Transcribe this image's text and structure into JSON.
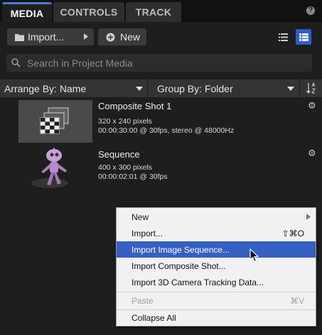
{
  "tabs": [
    {
      "label": "MEDIA",
      "active": true
    },
    {
      "label": "CONTROLS",
      "active": false
    },
    {
      "label": "TRACK",
      "active": false
    }
  ],
  "help_label": "?",
  "toolbar": {
    "import_label": "Import...",
    "new_label": "New"
  },
  "search": {
    "placeholder": "Search in Project Media",
    "value": ""
  },
  "sort": {
    "arrange_label": "Arrange By: Name",
    "group_label": "Group By: Folder"
  },
  "items": [
    {
      "title": "Composite Shot 1",
      "meta1": "320 x 240 pixels",
      "meta2": "00:00:30:00 @ 30fps, stereo @ 48000Hz"
    },
    {
      "title": "Sequence",
      "meta1": "400 x 300 pixels",
      "meta2": "00:00:02:01 @ 30fps"
    }
  ],
  "context_menu": {
    "items": [
      {
        "label": "New",
        "shortcut": "",
        "submenu": true
      },
      {
        "label": "Import...",
        "shortcut": "⇧⌘O"
      },
      {
        "label": "Import Image Sequence...",
        "shortcut": "",
        "highlighted": true
      },
      {
        "label": "Import Composite Shot...",
        "shortcut": ""
      },
      {
        "label": "Import 3D Camera Tracking Data...",
        "shortcut": ""
      },
      {
        "label": "Paste",
        "shortcut": "⌘V",
        "disabled": true
      },
      {
        "label": "Collapse All",
        "shortcut": ""
      }
    ]
  },
  "colors": {
    "accent": "#4a7cd6",
    "highlight": "#3460c2",
    "panel": "#1e1e1e"
  },
  "icons": [
    "folder-icon",
    "chevron-right-icon",
    "add-circle-icon",
    "list-view-icon",
    "grid-view-icon",
    "search-icon",
    "sort-icon",
    "gear-icon",
    "help-icon",
    "submenu-arrow-icon",
    "cursor-icon"
  ]
}
